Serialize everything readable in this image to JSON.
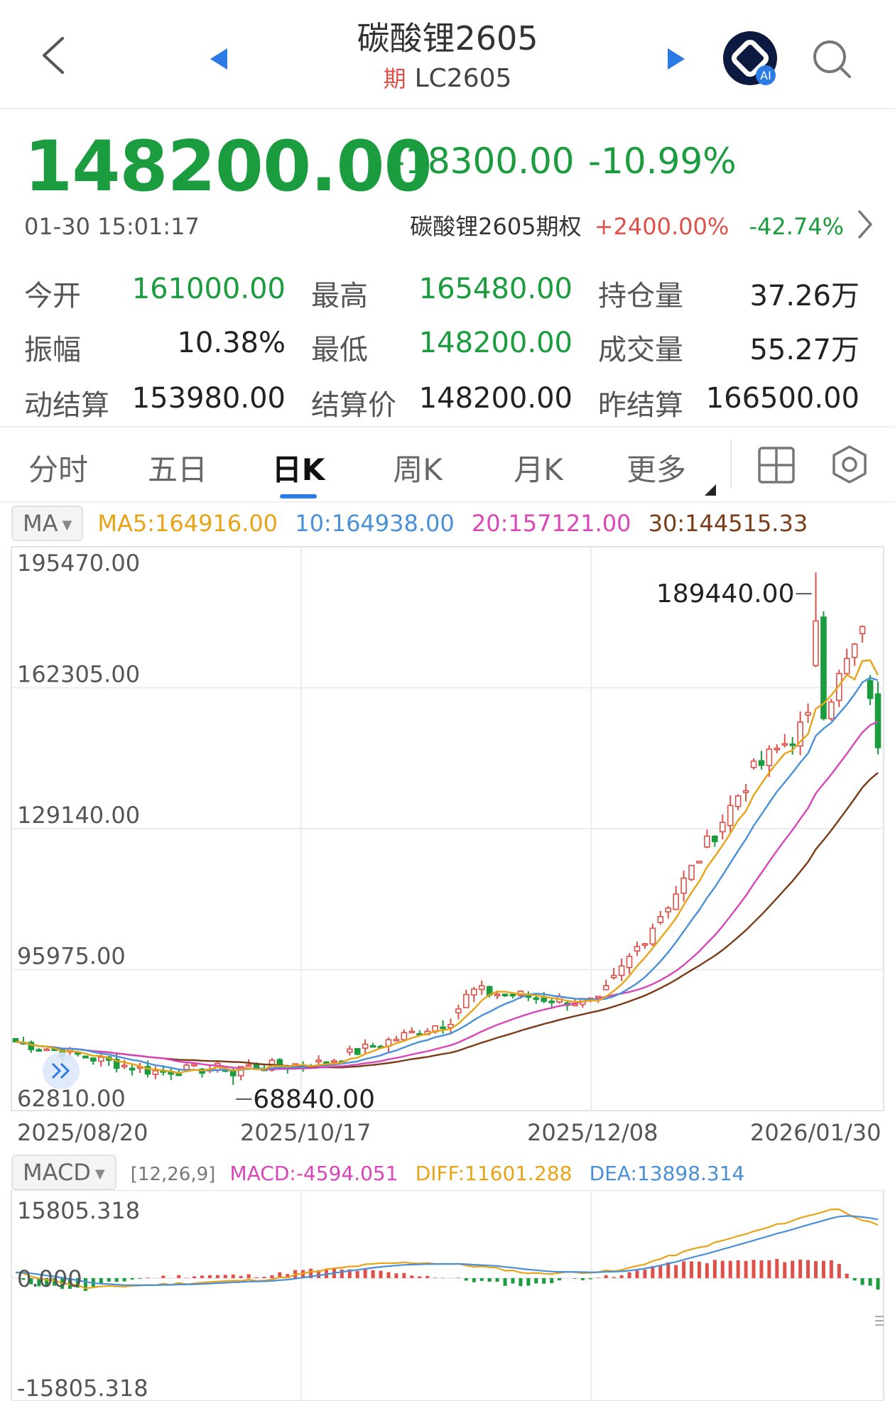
{
  "header": {
    "title": "碳酸锂2605",
    "badge": "期",
    "code": "LC2605"
  },
  "quote": {
    "price": "148200.00",
    "change": "-18300.00",
    "change_pct": "-10.99%",
    "time": "01-30 15:01:17",
    "option_name": "碳酸锂2605期权",
    "option_change1": "+2400.00%",
    "option_change2": "-42.74%"
  },
  "stats": [
    {
      "label": "今开",
      "value": "161000.00",
      "color": "#1a9c3f"
    },
    {
      "label": "最高",
      "value": "165480.00",
      "color": "#1a9c3f"
    },
    {
      "label": "持仓量",
      "value": "37.26万",
      "color": "#222222"
    },
    {
      "label": "振幅",
      "value": "10.38%",
      "color": "#222222"
    },
    {
      "label": "最低",
      "value": "148200.00",
      "color": "#1a9c3f"
    },
    {
      "label": "成交量",
      "value": "55.27万",
      "color": "#222222"
    },
    {
      "label": "动结算",
      "value": "153980.00",
      "color": "#222222"
    },
    {
      "label": "结算价",
      "value": "148200.00",
      "color": "#222222"
    },
    {
      "label": "昨结算",
      "value": "166500.00",
      "color": "#222222"
    }
  ],
  "tabs": [
    "分时",
    "五日",
    "日K",
    "周K",
    "月K",
    "更多"
  ],
  "active_tab": 2,
  "ma": {
    "chip": "MA",
    "ma5": "MA5:164916.00",
    "ma10": "10:164938.00",
    "ma20": "20:157121.00",
    "ma30": "30:144515.33"
  },
  "colors": {
    "up": "#e0504a",
    "down": "#1a9c3f",
    "ma5": "#e8a317",
    "ma10": "#4a90d9",
    "ma20": "#d946b8",
    "ma30": "#7a3b17",
    "accent": "#2c7be5"
  },
  "main_chart": {
    "y_labels": [
      "195470.00",
      "162305.00",
      "129140.00",
      "95975.00",
      "62810.00"
    ],
    "high_marker": "189440.00",
    "low_marker": "68840.00",
    "dates": [
      "2025/08/20",
      "2025/10/17",
      "2025/12/08",
      "2026/01/30"
    ]
  },
  "macd": {
    "chip": "MACD",
    "params": "[12,26,9]",
    "macd": "MACD:-4594.051",
    "diff": "DIFF:11601.288",
    "dea": "DEA:13898.314",
    "y_labels": [
      "15805.318",
      "0.000",
      "-15805.318"
    ]
  },
  "chart_data": {
    "type": "candlestick",
    "x_range": [
      "2025/08/20",
      "2026/01/30"
    ],
    "y_range": [
      62810,
      195470
    ],
    "anchors": [
      {
        "date": "2025/08/20",
        "close": 79000
      },
      {
        "date": "2025/09/15",
        "close": 72000
      },
      {
        "date": "2025/10/17",
        "close": 74000
      },
      {
        "date": "2025/11/10",
        "close": 84000
      },
      {
        "date": "2025/11/14",
        "close": 91000
      },
      {
        "date": "2025/12/08",
        "close": 88000
      },
      {
        "date": "2025/12/25",
        "close": 118000
      },
      {
        "date": "2026/01/06",
        "close": 142000
      },
      {
        "date": "2026/01/20",
        "close": 158000
      },
      {
        "date": "2026/01/27",
        "close": 175000
      },
      {
        "date": "2026/01/30",
        "close": 148200
      }
    ],
    "high": 189440,
    "low": 68840,
    "macd_range": [
      -15805.318,
      15805.318
    ]
  }
}
